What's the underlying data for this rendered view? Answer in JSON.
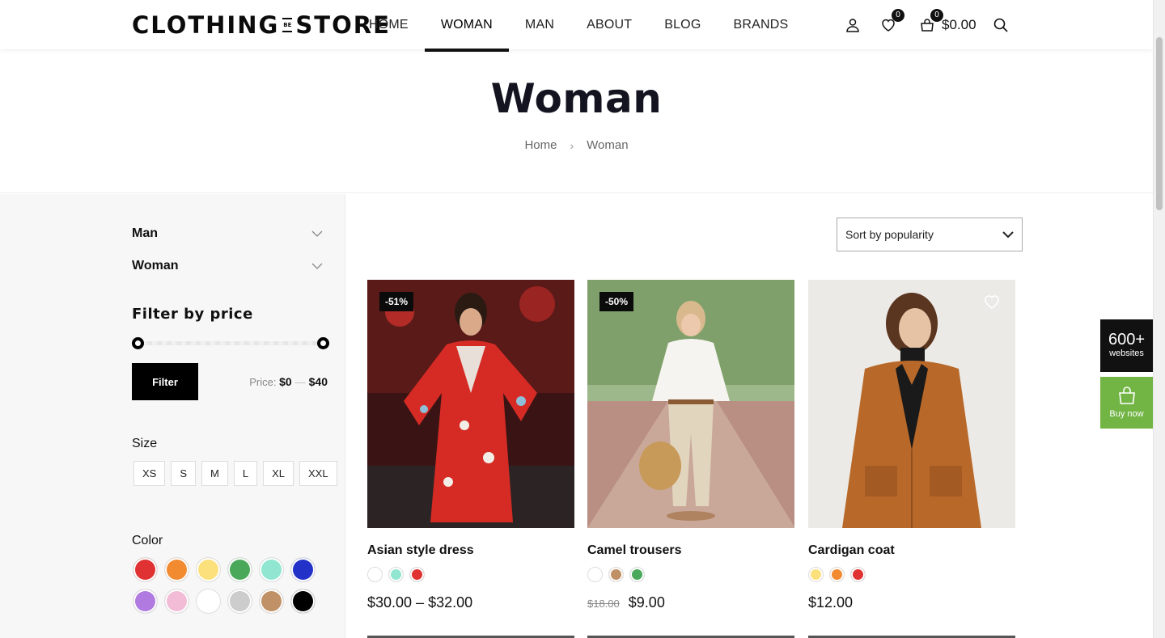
{
  "brand": {
    "logo_left": "CLOTHING",
    "logo_mid": "BE",
    "logo_right": "STORE"
  },
  "nav": [
    {
      "label": "HOME"
    },
    {
      "label": "WOMAN",
      "active": true
    },
    {
      "label": "MAN"
    },
    {
      "label": "ABOUT"
    },
    {
      "label": "BLOG"
    },
    {
      "label": "BRANDS"
    }
  ],
  "header": {
    "wishlist_count": "0",
    "cart_count": "0",
    "cart_total": "$0.00"
  },
  "hero": {
    "title": "Woman",
    "breadcrumb": [
      "Home",
      "Woman"
    ]
  },
  "sidebar": {
    "categories": [
      "Man",
      "Woman"
    ],
    "filter_title": "Filter by price",
    "filter_button": "Filter",
    "price_prefix": "Price:",
    "price_min": "$0",
    "price_max": "$40",
    "price_range_selected": {
      "min_fraction": 0.0,
      "max_fraction": 1.0
    },
    "size_title": "Size",
    "sizes": [
      "XS",
      "S",
      "M",
      "L",
      "XL",
      "XXL"
    ],
    "color_title": "Color",
    "colors": [
      "#e03232",
      "#f28a30",
      "#fbe07c",
      "#4aa85a",
      "#90e6d0",
      "#2232c8",
      "#b07ae0",
      "#f2bcd6",
      "#ffffff",
      "#cccccc",
      "#c09066",
      "#000000"
    ]
  },
  "sort": {
    "selected": "Sort by popularity"
  },
  "products": [
    {
      "name": "Asian style dress",
      "badge": "-51%",
      "swatches": [
        "#ffffff",
        "#90e6d0",
        "#e03232"
      ],
      "price": "$30.00 – $32.00",
      "old_price": ""
    },
    {
      "name": "Camel trousers",
      "badge": "-50%",
      "swatches": [
        "#ffffff",
        "#c09066",
        "#4aa85a"
      ],
      "price": "$9.00",
      "old_price": "$18.00"
    },
    {
      "name": "Cardigan coat",
      "badge": "",
      "swatches": [
        "#fbe07c",
        "#f28a30",
        "#e03232"
      ],
      "price": "$12.00",
      "old_price": ""
    }
  ],
  "floating": {
    "sites_big": "600+",
    "sites_small": "websites",
    "buy_label": "Buy now"
  }
}
